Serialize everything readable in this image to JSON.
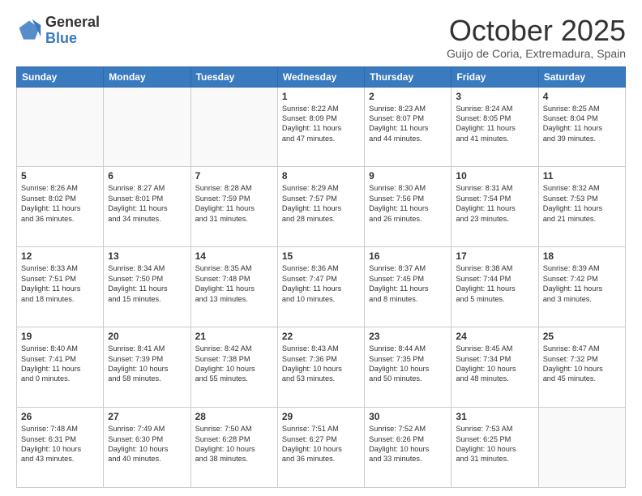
{
  "header": {
    "logo_general": "General",
    "logo_blue": "Blue",
    "month_title": "October 2025",
    "subtitle": "Guijo de Coria, Extremadura, Spain"
  },
  "days_of_week": [
    "Sunday",
    "Monday",
    "Tuesday",
    "Wednesday",
    "Thursday",
    "Friday",
    "Saturday"
  ],
  "weeks": [
    [
      {
        "day": "",
        "text": ""
      },
      {
        "day": "",
        "text": ""
      },
      {
        "day": "",
        "text": ""
      },
      {
        "day": "1",
        "text": "Sunrise: 8:22 AM\nSunset: 8:09 PM\nDaylight: 11 hours\nand 47 minutes."
      },
      {
        "day": "2",
        "text": "Sunrise: 8:23 AM\nSunset: 8:07 PM\nDaylight: 11 hours\nand 44 minutes."
      },
      {
        "day": "3",
        "text": "Sunrise: 8:24 AM\nSunset: 8:05 PM\nDaylight: 11 hours\nand 41 minutes."
      },
      {
        "day": "4",
        "text": "Sunrise: 8:25 AM\nSunset: 8:04 PM\nDaylight: 11 hours\nand 39 minutes."
      }
    ],
    [
      {
        "day": "5",
        "text": "Sunrise: 8:26 AM\nSunset: 8:02 PM\nDaylight: 11 hours\nand 36 minutes."
      },
      {
        "day": "6",
        "text": "Sunrise: 8:27 AM\nSunset: 8:01 PM\nDaylight: 11 hours\nand 34 minutes."
      },
      {
        "day": "7",
        "text": "Sunrise: 8:28 AM\nSunset: 7:59 PM\nDaylight: 11 hours\nand 31 minutes."
      },
      {
        "day": "8",
        "text": "Sunrise: 8:29 AM\nSunset: 7:57 PM\nDaylight: 11 hours\nand 28 minutes."
      },
      {
        "day": "9",
        "text": "Sunrise: 8:30 AM\nSunset: 7:56 PM\nDaylight: 11 hours\nand 26 minutes."
      },
      {
        "day": "10",
        "text": "Sunrise: 8:31 AM\nSunset: 7:54 PM\nDaylight: 11 hours\nand 23 minutes."
      },
      {
        "day": "11",
        "text": "Sunrise: 8:32 AM\nSunset: 7:53 PM\nDaylight: 11 hours\nand 21 minutes."
      }
    ],
    [
      {
        "day": "12",
        "text": "Sunrise: 8:33 AM\nSunset: 7:51 PM\nDaylight: 11 hours\nand 18 minutes."
      },
      {
        "day": "13",
        "text": "Sunrise: 8:34 AM\nSunset: 7:50 PM\nDaylight: 11 hours\nand 15 minutes."
      },
      {
        "day": "14",
        "text": "Sunrise: 8:35 AM\nSunset: 7:48 PM\nDaylight: 11 hours\nand 13 minutes."
      },
      {
        "day": "15",
        "text": "Sunrise: 8:36 AM\nSunset: 7:47 PM\nDaylight: 11 hours\nand 10 minutes."
      },
      {
        "day": "16",
        "text": "Sunrise: 8:37 AM\nSunset: 7:45 PM\nDaylight: 11 hours\nand 8 minutes."
      },
      {
        "day": "17",
        "text": "Sunrise: 8:38 AM\nSunset: 7:44 PM\nDaylight: 11 hours\nand 5 minutes."
      },
      {
        "day": "18",
        "text": "Sunrise: 8:39 AM\nSunset: 7:42 PM\nDaylight: 11 hours\nand 3 minutes."
      }
    ],
    [
      {
        "day": "19",
        "text": "Sunrise: 8:40 AM\nSunset: 7:41 PM\nDaylight: 11 hours\nand 0 minutes."
      },
      {
        "day": "20",
        "text": "Sunrise: 8:41 AM\nSunset: 7:39 PM\nDaylight: 10 hours\nand 58 minutes."
      },
      {
        "day": "21",
        "text": "Sunrise: 8:42 AM\nSunset: 7:38 PM\nDaylight: 10 hours\nand 55 minutes."
      },
      {
        "day": "22",
        "text": "Sunrise: 8:43 AM\nSunset: 7:36 PM\nDaylight: 10 hours\nand 53 minutes."
      },
      {
        "day": "23",
        "text": "Sunrise: 8:44 AM\nSunset: 7:35 PM\nDaylight: 10 hours\nand 50 minutes."
      },
      {
        "day": "24",
        "text": "Sunrise: 8:45 AM\nSunset: 7:34 PM\nDaylight: 10 hours\nand 48 minutes."
      },
      {
        "day": "25",
        "text": "Sunrise: 8:47 AM\nSunset: 7:32 PM\nDaylight: 10 hours\nand 45 minutes."
      }
    ],
    [
      {
        "day": "26",
        "text": "Sunrise: 7:48 AM\nSunset: 6:31 PM\nDaylight: 10 hours\nand 43 minutes."
      },
      {
        "day": "27",
        "text": "Sunrise: 7:49 AM\nSunset: 6:30 PM\nDaylight: 10 hours\nand 40 minutes."
      },
      {
        "day": "28",
        "text": "Sunrise: 7:50 AM\nSunset: 6:28 PM\nDaylight: 10 hours\nand 38 minutes."
      },
      {
        "day": "29",
        "text": "Sunrise: 7:51 AM\nSunset: 6:27 PM\nDaylight: 10 hours\nand 36 minutes."
      },
      {
        "day": "30",
        "text": "Sunrise: 7:52 AM\nSunset: 6:26 PM\nDaylight: 10 hours\nand 33 minutes."
      },
      {
        "day": "31",
        "text": "Sunrise: 7:53 AM\nSunset: 6:25 PM\nDaylight: 10 hours\nand 31 minutes."
      },
      {
        "day": "",
        "text": ""
      }
    ]
  ]
}
